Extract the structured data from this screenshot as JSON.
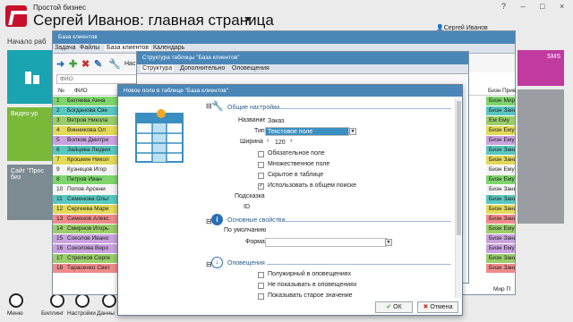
{
  "app": {
    "subtitle": "Простой бизнес",
    "title": "Сергей Иванов: главная страница",
    "user": "Сергей Иванов",
    "start_label": "Начало раб",
    "window_controls": "? – □ ×",
    "colors": {
      "accent": "#4a86b8",
      "brand": "#c8102e"
    }
  },
  "tiles": {
    "video": "Видео-ур",
    "site": "Сайт \"Прос биз",
    "sms": "SMS"
  },
  "bottom": [
    "Меню",
    "Биллинг",
    "Настройки",
    "Данны"
  ],
  "win1": {
    "title": "База клиентов",
    "tabs": [
      "Задача",
      "Файлы",
      "База клиентов",
      "Календарь"
    ],
    "tool_label": "Нас",
    "search_placeholder": "ФИО",
    "col_num": "№",
    "col_name": "ФИО",
    "col_right": "Бизн",
    "col_right2": "Прие",
    "status": "Мир П",
    "rows": [
      {
        "n": "1",
        "name": "Беляева Анна",
        "c": "Бизн",
        "c2": "Мир",
        "color": "#7ed56b"
      },
      {
        "n": "2",
        "name": "Богданова Све",
        "c": "Бизн",
        "c2": "Зани",
        "color": "#58c7c0"
      },
      {
        "n": "3",
        "name": "Ветров Никола",
        "c": "Ем",
        "c2": "Ему",
        "color": "#9acd6a"
      },
      {
        "n": "4",
        "name": "Винникова Ол",
        "c": "Бизн",
        "c2": "Ему",
        "color": "#e3d95a"
      },
      {
        "n": "5",
        "name": "Волков Дмитри",
        "c": "Бизн",
        "c2": "Ему",
        "color": "#c9a2df"
      },
      {
        "n": "6",
        "name": "Зайцева Людми",
        "c": "Бизн",
        "c2": "Зани",
        "color": "#58c7c0"
      },
      {
        "n": "7",
        "name": "Крошкин Никол",
        "c": "Бизн",
        "c2": "Зани",
        "color": "#e3d95a"
      },
      {
        "n": "9",
        "name": "Кузнецов Игор",
        "c": "Бизн",
        "c2": "Ему",
        "color": "#f4f4f4"
      },
      {
        "n": "8",
        "name": "Петров Иван",
        "c": "Бизн",
        "c2": "Ему",
        "color": "#7ed56b"
      },
      {
        "n": "10",
        "name": "Попов Арсени",
        "c": "Бизн",
        "c2": "Зани",
        "color": "#f4f4f4"
      },
      {
        "n": "11",
        "name": "Семенова Ольг",
        "c": "Бизн",
        "c2": "Зани",
        "color": "#58c7c0"
      },
      {
        "n": "12",
        "name": "Сергеева Мари",
        "c": "Бизн",
        "c2": "Зани",
        "color": "#e3d95a"
      },
      {
        "n": "13",
        "name": "Симонов Алекс",
        "c": "Бизн",
        "c2": "Зани",
        "color": "#f08a8a"
      },
      {
        "n": "14",
        "name": "Смирнов Игорь",
        "c": "Бизн",
        "c2": "Ему",
        "color": "#9acd6a"
      },
      {
        "n": "15",
        "name": "Соколов Ивано",
        "c": "Бизн",
        "c2": "Зани",
        "color": "#c9a2df"
      },
      {
        "n": "16",
        "name": "Соколова Веро",
        "c": "Бизн",
        "c2": "Ему",
        "color": "#c9a2df"
      },
      {
        "n": "17",
        "name": "Стрелков Серге",
        "c": "Бизн",
        "c2": "Зани",
        "color": "#9acd6a"
      },
      {
        "n": "18",
        "name": "Тарасенко Свет",
        "c": "Бизн",
        "c2": "Зани",
        "color": "#f08a8a"
      }
    ]
  },
  "win2": {
    "title": "Структура таблицы \"База клиентов\"",
    "tabs": [
      "Структура",
      "Дополнительно",
      "Оповещения"
    ]
  },
  "dialog": {
    "title": "Новое поле в таблице \"База клиентов\"",
    "sec_general": "Общие настройки",
    "sec_main": "Основные свойства",
    "sec_notify": "Оповещения",
    "name_label": "Название",
    "name_value": "Заказ",
    "type_label": "Тип",
    "type_value": "Текстовое поле",
    "width_label": "Ширина",
    "width_value": "120",
    "checkboxes": [
      {
        "label": "Обязательное поле",
        "checked": false
      },
      {
        "label": "Множественное поле",
        "checked": false
      },
      {
        "label": "Скрытое в таблице",
        "checked": false
      },
      {
        "label": "Использовать в общем поиске",
        "checked": true
      }
    ],
    "hint_label": "Подсказка",
    "id_label": "ID",
    "default_label": "По умолчанию",
    "format_label": "Формат",
    "notify_checkboxes": [
      {
        "label": "Полужирный в оповещениях",
        "checked": false
      },
      {
        "label": "Не показывать в оповещениях",
        "checked": false
      },
      {
        "label": "Показывать старое значение",
        "checked": false
      }
    ],
    "ok": "ОК",
    "cancel": "Отмена"
  }
}
